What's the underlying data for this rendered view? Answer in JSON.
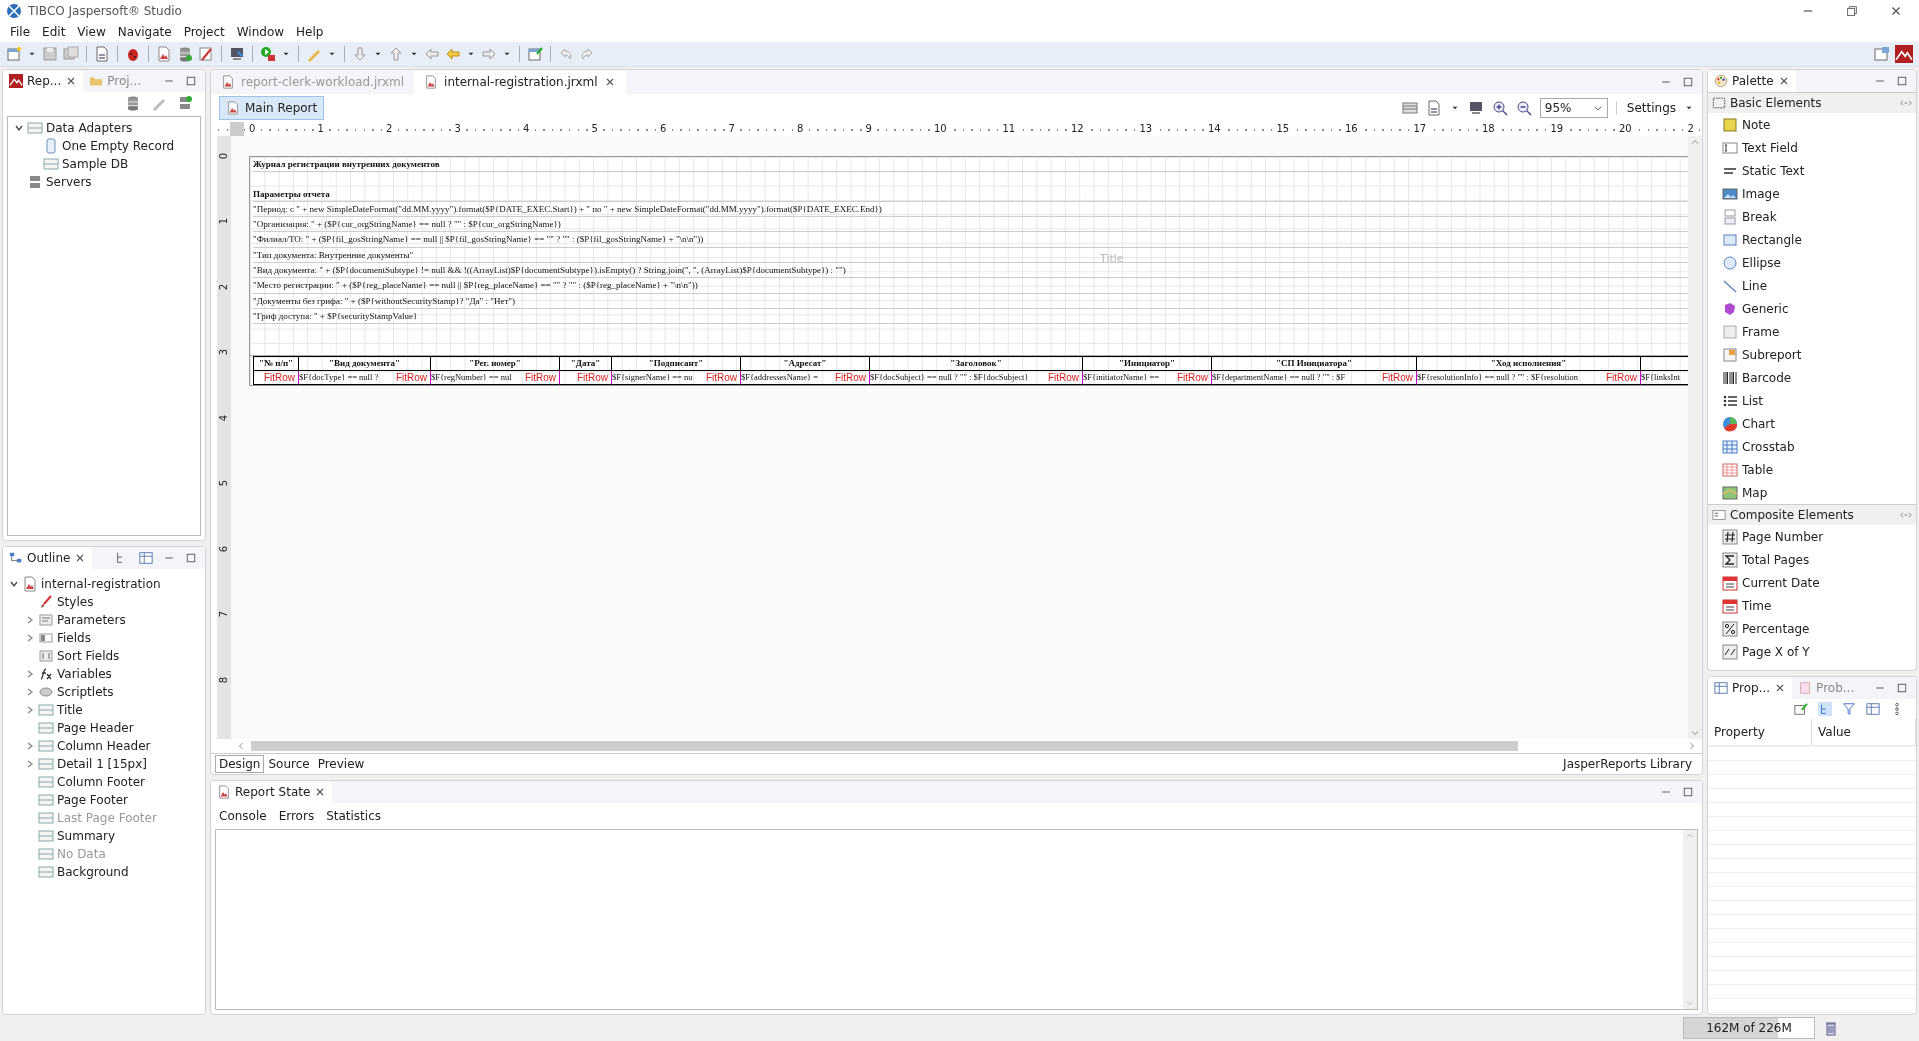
{
  "window": {
    "title": "TIBCO Jaspersoft® Studio"
  },
  "menu": [
    "File",
    "Edit",
    "View",
    "Navigate",
    "Project",
    "Window",
    "Help"
  ],
  "left_panel": {
    "tabs": [
      {
        "label": "Rep...",
        "selected": true
      },
      {
        "label": "Proj...",
        "selected": false
      }
    ],
    "tree": [
      {
        "label": "Data Adapters",
        "kind": "database",
        "expandable": true,
        "expanded": true,
        "children": [
          {
            "label": "One Empty Record",
            "kind": "record",
            "expandable": false
          },
          {
            "label": "Sample DB",
            "kind": "database",
            "expandable": false
          }
        ]
      },
      {
        "label": "Servers",
        "kind": "server",
        "expandable": false
      }
    ]
  },
  "outline": {
    "title": "Outline",
    "tree": [
      {
        "label": "internal-registration",
        "kind": "report",
        "expandable": true,
        "expanded": true,
        "disabled": false,
        "children": [
          {
            "label": "Styles",
            "kind": "brush",
            "expandable": false,
            "disabled": false
          },
          {
            "label": "Parameters",
            "kind": "params",
            "expandable": true,
            "expanded": false,
            "disabled": false
          },
          {
            "label": "Fields",
            "kind": "fields",
            "expandable": true,
            "expanded": false,
            "disabled": false
          },
          {
            "label": "Sort Fields",
            "kind": "sort",
            "expandable": false,
            "disabled": false
          },
          {
            "label": "Variables",
            "kind": "variables",
            "expandable": true,
            "expanded": false,
            "disabled": false
          },
          {
            "label": "Scriptlets",
            "kind": "scriptlet",
            "expandable": true,
            "expanded": false,
            "disabled": false
          },
          {
            "label": "Title",
            "kind": "band",
            "expandable": true,
            "expanded": false,
            "disabled": false
          },
          {
            "label": "Page Header",
            "kind": "band",
            "expandable": false,
            "disabled": false
          },
          {
            "label": "Column Header",
            "kind": "band",
            "expandable": true,
            "expanded": false,
            "disabled": false
          },
          {
            "label": "Detail 1 [15px]",
            "kind": "band",
            "expandable": true,
            "expanded": false,
            "disabled": false
          },
          {
            "label": "Column Footer",
            "kind": "band",
            "expandable": false,
            "disabled": false
          },
          {
            "label": "Page Footer",
            "kind": "band",
            "expandable": false,
            "disabled": false
          },
          {
            "label": "Last Page Footer",
            "kind": "band",
            "expandable": false,
            "disabled": true
          },
          {
            "label": "Summary",
            "kind": "band",
            "expandable": false,
            "disabled": false
          },
          {
            "label": "No Data",
            "kind": "band",
            "expandable": false,
            "disabled": true
          },
          {
            "label": "Background",
            "kind": "band",
            "expandable": false,
            "disabled": false
          }
        ]
      }
    ]
  },
  "editor": {
    "tabs": [
      {
        "label": "report-clerk-workload.jrxml",
        "selected": false
      },
      {
        "label": "internal-registration.jrxml",
        "selected": true
      }
    ],
    "main_report": "Main Report",
    "zoom": "95%",
    "settings": "Settings",
    "ruler_h": [
      "0",
      "1",
      "2",
      "3",
      "4",
      "5",
      "6",
      "7",
      "8",
      "9",
      "10",
      "11",
      "12",
      "13",
      "14",
      "15",
      "16",
      "17",
      "18",
      "19",
      "20",
      "2"
    ],
    "ruler_v": [
      "0",
      "1",
      "2",
      "3",
      "4",
      "5",
      "6",
      "7",
      "8"
    ],
    "report": {
      "band_label": "Title",
      "heading": "Журнал регистрации внутренних документов",
      "params_heading": "Параметры отчета",
      "params": [
        "\"Период: с \" + new SimpleDateFormat(\"dd.MM.yyyy\").format($P{DATE_EXEC.Start}) + \" по \" + new SimpleDateFormat(\"dd.MM.yyyy\").format($P{DATE_EXEC.End})",
        "\"Организация: \" + ($P{cur_orgStringName} == null ? \"\" : $P{cur_orgStringName})",
        "\"Филиал/ТО: \" + ($P{fil_gosStringName} == null || $P{fil_gosStringName} == \"\" ? \"\" : ($P{fil_gosStringName} + \"\\n\\n\"))",
        "\"Тип документа: Внутренние документы\"",
        "\"Вид документа: \" + ($P{documentSubtype} != null && !((ArrayList)$P{documentSubtype}).isEmpty() ? String.join(\", \", (ArrayList)$P{documentSubtype}) : \"\")",
        "\"Место регистрации: \" + ($P{reg_placeName} == null || $P{reg_placeName} == \"\" ? \"\" : ($P{reg_placeName} + \"\\n\\n\"))",
        "\"Документы без грифа: \" + ($P{withoutSecurityStamp}? \"Да\" : \"Нет\")",
        "\"Гриф доступа: \" + $P{securityStampValue}"
      ],
      "columns": [
        {
          "header": "\"№ п/п\"",
          "marker": "FitRow"
        },
        {
          "header": "\"Вид документа\"",
          "expression": "$F{docType} == null ?",
          "marker": "FitRow"
        },
        {
          "header": "\"Рег. номер\"",
          "expression": "$F{regNumber} == nul",
          "marker": "FitRow"
        },
        {
          "header": "\"Дата\"",
          "marker": "FitRow"
        },
        {
          "header": "\"Подписант\"",
          "expression": "$F{signerName} == nu",
          "marker": "FitRow"
        },
        {
          "header": "\"Адресат\"",
          "expression": "$F{addressesName} =",
          "marker": "FitRow"
        },
        {
          "header": "\"Заголовок\"",
          "expression": "$F{docSubject} == null ? \"\" : $F{docSubject}",
          "marker": "FitRow"
        },
        {
          "header": "\"Инициатор\"",
          "expression": "$F{initiatorName} ==",
          "marker": "FitRow"
        },
        {
          "header": "\"СП Инициатора\"",
          "expression": "$F{departmentName} == null ? \"\" : $F",
          "marker": "FitRow"
        },
        {
          "header": "\"Ход исполнения\"",
          "expression": "$F{resolutionInfo} == null ? \"\" : $F{resolution",
          "marker": "FitRow"
        },
        {
          "expression": "$F{linksInt"
        }
      ]
    },
    "bottom_tabs": [
      {
        "label": "Design",
        "selected": true
      },
      {
        "label": "Source",
        "selected": false
      },
      {
        "label": "Preview",
        "selected": false
      }
    ],
    "library": "JasperReports Library"
  },
  "report_state": {
    "title": "Report State",
    "tabs": [
      "Console",
      "Errors",
      "Statistics"
    ]
  },
  "palette": {
    "title": "Palette",
    "sections": [
      {
        "title": "Basic Elements",
        "items": [
          {
            "label": "Note",
            "kind": "note"
          },
          {
            "label": "Text Field",
            "kind": "textfield"
          },
          {
            "label": "Static Text",
            "kind": "label"
          },
          {
            "label": "Image",
            "kind": "image"
          },
          {
            "label": "Break",
            "kind": "break"
          },
          {
            "label": "Rectangle",
            "kind": "rectangle"
          },
          {
            "label": "Ellipse",
            "kind": "ellipse"
          },
          {
            "label": "Line",
            "kind": "line"
          },
          {
            "label": "Generic",
            "kind": "generic"
          },
          {
            "label": "Frame",
            "kind": "frame"
          },
          {
            "label": "Subreport",
            "kind": "subreport"
          },
          {
            "label": "Barcode",
            "kind": "barcode"
          },
          {
            "label": "List",
            "kind": "list"
          },
          {
            "label": "Chart",
            "kind": "chart"
          },
          {
            "label": "Crosstab",
            "kind": "crosstab"
          },
          {
            "label": "Table",
            "kind": "table"
          },
          {
            "label": "Map",
            "kind": "map"
          }
        ]
      },
      {
        "title": "Composite Elements",
        "items": [
          {
            "label": "Page Number",
            "kind": "hash"
          },
          {
            "label": "Total Pages",
            "kind": "sigma"
          },
          {
            "label": "Current Date",
            "kind": "calendar"
          },
          {
            "label": "Time",
            "kind": "calendar"
          },
          {
            "label": "Percentage",
            "kind": "percent"
          },
          {
            "label": "Page X of Y",
            "kind": "fraction"
          }
        ]
      }
    ]
  },
  "properties": {
    "tabs": [
      {
        "label": "Prop...",
        "selected": true
      },
      {
        "label": "Prob...",
        "selected": false
      }
    ],
    "columns": [
      "Property",
      "Value"
    ]
  },
  "status_bar": {
    "memory": {
      "text": "162M of 226M",
      "level": 0.72
    }
  }
}
